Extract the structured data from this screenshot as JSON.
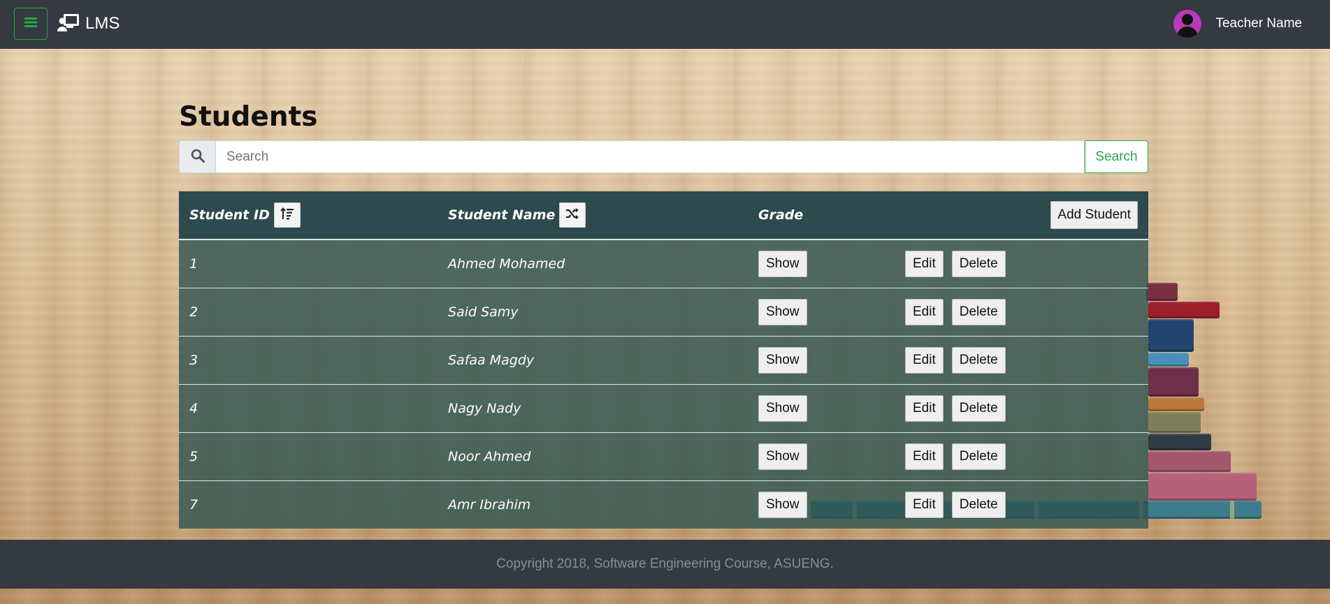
{
  "navbar": {
    "menu_icon": "hamburger-icon",
    "brand_icon": "teacher-board-icon",
    "brand": "LMS",
    "user_name": "Teacher Name",
    "avatar_icon": "user-avatar-icon"
  },
  "page": {
    "title": "Students"
  },
  "search": {
    "icon": "search-icon",
    "placeholder": "Search",
    "value": "",
    "button_label": "Search"
  },
  "table": {
    "headers": {
      "id": "Student ID",
      "name": "Student Name",
      "grade": "Grade",
      "id_sort_icon": "sort-ascending-icon",
      "name_sort_icon": "shuffle-icon",
      "add_button": "Add Student"
    },
    "row_actions": {
      "show": "Show",
      "edit": "Edit",
      "delete": "Delete"
    },
    "rows": [
      {
        "id": "1",
        "name": "Ahmed Mohamed"
      },
      {
        "id": "2",
        "name": "Said Samy"
      },
      {
        "id": "3",
        "name": "Safaa Magdy"
      },
      {
        "id": "4",
        "name": "Nagy Nady"
      },
      {
        "id": "5",
        "name": "Noor Ahmed"
      },
      {
        "id": "7",
        "name": "Amr Ibrahim"
      }
    ]
  },
  "footer": {
    "text": "Copyright 2018, Software Engineering Course, ASUENG."
  },
  "colors": {
    "navbar": "#343a40",
    "accent_green": "#28a745",
    "table_header": "#2d4a4e",
    "table_row": "#2d5350"
  }
}
